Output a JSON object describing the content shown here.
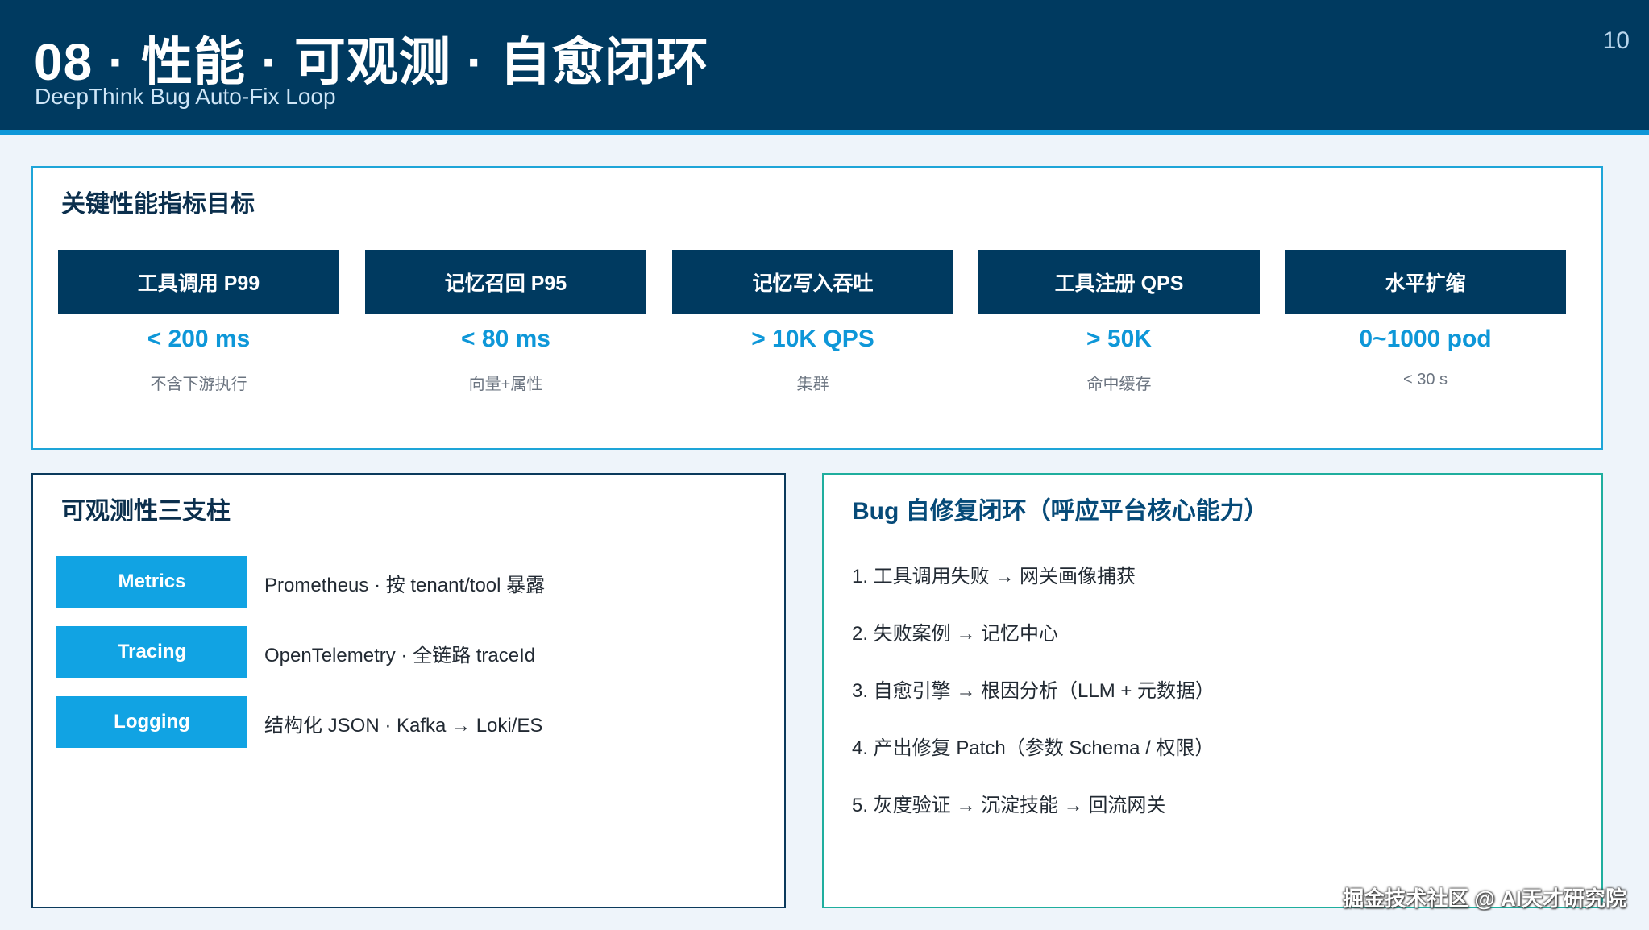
{
  "header": {
    "title": "08 · 性能 · 可观测 · 自愈闭环",
    "subtitle": "DeepThink Bug Auto-Fix Loop",
    "page_number": "10"
  },
  "kpi_panel": {
    "title": "关键性能指标目标",
    "cards": [
      {
        "label": "工具调用 P99",
        "value": "< 200 ms",
        "note": "不含下游执行"
      },
      {
        "label": "记忆召回 P95",
        "value": "< 80 ms",
        "note": "向量+属性"
      },
      {
        "label": "记忆写入吞吐",
        "value": "> 10K QPS",
        "note": "集群"
      },
      {
        "label": "工具注册 QPS",
        "value": "> 50K",
        "note": "命中缓存"
      },
      {
        "label": "水平扩缩",
        "value": "0~1000 pod",
        "note": "< 30 s"
      }
    ]
  },
  "observability_panel": {
    "title": "可观测性三支柱",
    "pillars": [
      {
        "tag": "Metrics",
        "desc": "Prometheus · 按 tenant/tool 暴露"
      },
      {
        "tag": "Tracing",
        "desc": "OpenTelemetry · 全链路 traceId"
      },
      {
        "tag": "Logging",
        "desc": "结构化 JSON · Kafka → Loki/ES"
      }
    ]
  },
  "bug_panel": {
    "title": "Bug 自修复闭环（呼应平台核心能力）",
    "steps": [
      "1. 工具调用失败 → 网关画像捕获",
      "2. 失败案例 → 记忆中心",
      "3. 自愈引擎 → 根因分析（LLM + 元数据）",
      "4. 产出修复 Patch（参数 Schema / 权限）",
      "5. 灰度验证 → 沉淀技能 → 回流网关"
    ]
  },
  "watermark": "掘金技术社区 @ AI天才研究院",
  "colors": {
    "header_bg": "#003a60",
    "accent_blue": "#0e97d8",
    "tag_blue": "#11a3e3",
    "kpi_border": "#1ea5d8",
    "bug_border": "#1fae9e"
  }
}
